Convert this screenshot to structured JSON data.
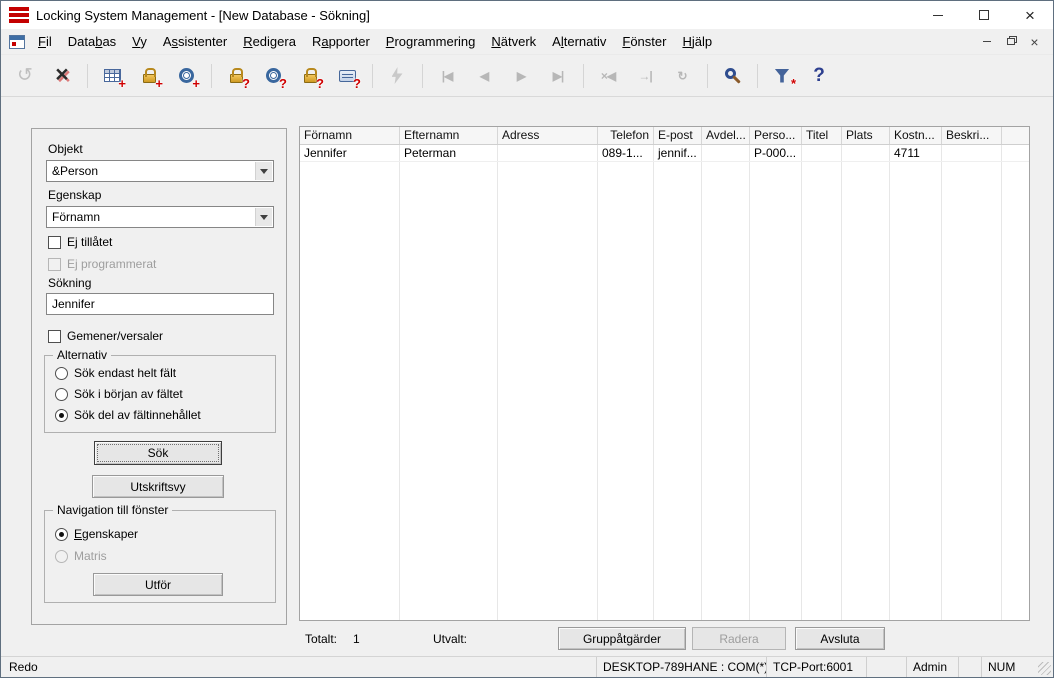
{
  "window": {
    "title": "Locking System Management - [New Database - Sökning]",
    "status_ready": "Redo",
    "status_segments": [
      "DESKTOP-789HANE : COM(*)",
      "TCP-Port:6001",
      "",
      "Admin",
      "",
      "NUM"
    ]
  },
  "menu": {
    "items": [
      "&Fil",
      "Data&bas",
      "&Vy",
      "A&ssistenter",
      "&Redigera",
      "R&apporter",
      "&Programmering",
      "&Nätverk",
      "A&lternativ",
      "&Fönster",
      "&Hjälp"
    ]
  },
  "toolbar": {
    "items": [
      {
        "name": "login-icon",
        "kind": "swirl",
        "glyph": "↺",
        "enabled": false
      },
      {
        "name": "logout-icon",
        "kind": "cross",
        "glyph": "×",
        "enabled": true
      },
      {
        "type": "sep"
      },
      {
        "name": "new-locking-system-icon",
        "kind": "grid",
        "badge": "+",
        "enabled": true
      },
      {
        "name": "new-lock-icon",
        "kind": "lock",
        "badge": "+",
        "enabled": true
      },
      {
        "name": "new-transponder-icon",
        "kind": "target",
        "badge": "+",
        "enabled": true
      },
      {
        "type": "sep"
      },
      {
        "name": "read-lock-icon",
        "kind": "lock",
        "badge": "?",
        "enabled": true
      },
      {
        "name": "read-transponder-icon",
        "kind": "target",
        "badge": "?",
        "enabled": true
      },
      {
        "name": "read-mifare-lock-icon",
        "kind": "lock",
        "badge": "?",
        "enabled": true
      },
      {
        "name": "read-card-icon",
        "kind": "card",
        "badge": "?",
        "enabled": true
      },
      {
        "type": "sep"
      },
      {
        "name": "program-icon",
        "kind": "bolt",
        "enabled": false
      },
      {
        "type": "sep"
      },
      {
        "name": "first-record-icon",
        "kind": "glyph",
        "glyph": "|◀",
        "enabled": false
      },
      {
        "name": "previous-record-icon",
        "kind": "glyph",
        "glyph": "◀",
        "enabled": false
      },
      {
        "name": "next-record-icon",
        "kind": "glyph",
        "glyph": "▶",
        "enabled": false
      },
      {
        "name": "last-record-icon",
        "kind": "glyph",
        "glyph": "▶|",
        "enabled": false
      },
      {
        "type": "sep"
      },
      {
        "name": "cancel-search-icon",
        "kind": "glyph",
        "glyph": "×◀",
        "enabled": false
      },
      {
        "name": "goto-end-icon",
        "kind": "glyph",
        "glyph": "→|",
        "enabled": false
      },
      {
        "name": "refresh-icon",
        "kind": "glyph",
        "glyph": "↻",
        "enabled": false
      },
      {
        "type": "sep"
      },
      {
        "name": "search-icon",
        "kind": "search",
        "enabled": true
      },
      {
        "type": "sep"
      },
      {
        "name": "filter-settings-icon",
        "kind": "funnel",
        "badge": "*",
        "enabled": true
      },
      {
        "name": "help-icon",
        "kind": "help",
        "glyph": "?",
        "enabled": true
      }
    ]
  },
  "search_panel": {
    "objekt": {
      "label": "Objekt",
      "value": "&Person"
    },
    "egenskap": {
      "label": "Egenskap",
      "value": "Förnamn"
    },
    "checkboxes": {
      "ej_tillatet": {
        "label": "Ej tillåtet",
        "checked": false,
        "enabled": true
      },
      "ej_programmerat": {
        "label": "Ej programmerat",
        "checked": false,
        "enabled": false
      },
      "gemener_versaler": {
        "label": "Gemener/versaler",
        "checked": false,
        "enabled": true
      }
    },
    "sokning": {
      "label": "Sökning",
      "value": "Jennifer"
    },
    "alternativ": {
      "title": "Alternativ",
      "options": [
        "Sök endast helt fält",
        "Sök i början av fältet",
        "Sök del av fältinnehållet"
      ],
      "selected": "Sök del av fältinnehållet"
    },
    "sok_button": "Sök",
    "utskriftsvy_button": "Utskriftsvy",
    "navigation": {
      "title": "Navigation till fönster",
      "options": [
        "Egenskaper",
        "Matris"
      ],
      "selected": "Egenskaper",
      "matris_enabled": false,
      "utfor_button": "Utför"
    }
  },
  "results": {
    "columns": [
      "Förnamn",
      "Efternamn",
      "Adress",
      "Telefon",
      "E-post",
      "Avdel...",
      "Perso...",
      "Titel",
      "Plats",
      "Kostn...",
      "Beskri..."
    ],
    "rows": [
      [
        "Jennifer",
        "Peterman",
        "",
        "089-1...",
        "jennif...",
        "",
        "P-000...",
        "",
        "",
        "4711",
        ""
      ]
    ],
    "totalt_label": "Totalt:",
    "totalt_value": "1",
    "utvalt_label": "Utvalt:",
    "buttons": {
      "grupp": "Gruppåtgärder",
      "radera": "Radera",
      "avsluta": "Avsluta"
    }
  },
  "colors": {
    "logo_red": "#c40000",
    "badge_red": "#cf0000",
    "icon_gold": "#cf9a22",
    "icon_blue": "#39679e"
  }
}
